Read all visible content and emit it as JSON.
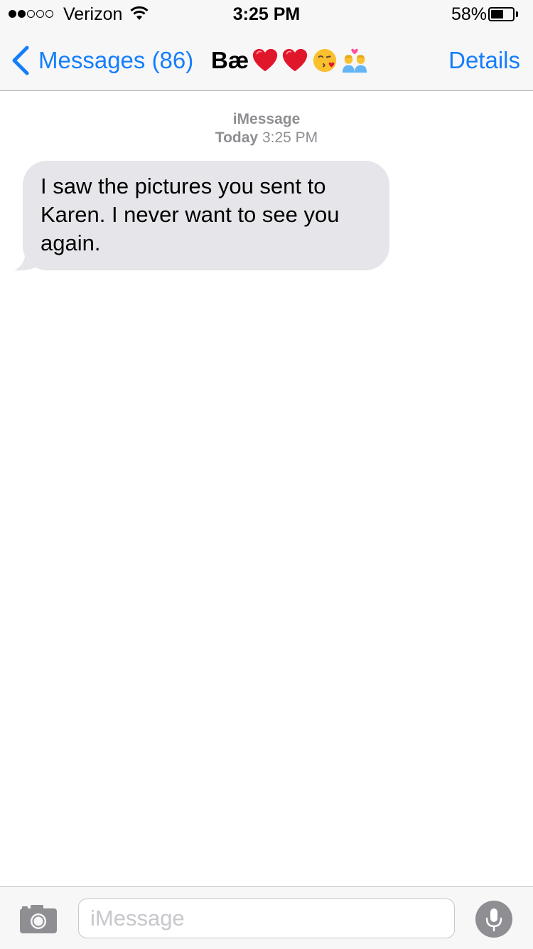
{
  "status_bar": {
    "signal_bars": 2,
    "signal_total": 5,
    "carrier": "Verizon",
    "time": "3:25 PM",
    "battery_percent": "58%",
    "battery_level": 0.58
  },
  "nav": {
    "back_label": "Messages (86)",
    "contact_name": "Bæ",
    "contact_emoji": [
      "red-heart-icon",
      "red-heart-icon",
      "kissing-face-icon",
      "couple-with-heart-icon"
    ],
    "details_label": "Details"
  },
  "conversation": {
    "service": "iMessage",
    "day": "Today",
    "time": "3:25 PM",
    "messages": [
      {
        "direction": "incoming",
        "text": "I saw the pictures you sent to Karen. I never want to see you again."
      }
    ]
  },
  "input_bar": {
    "placeholder": "iMessage",
    "value": ""
  },
  "colors": {
    "accent": "#157efb",
    "incoming_bubble": "#e5e5ea",
    "bar_background": "#f7f7f8",
    "secondary_text": "#8e8e93"
  }
}
